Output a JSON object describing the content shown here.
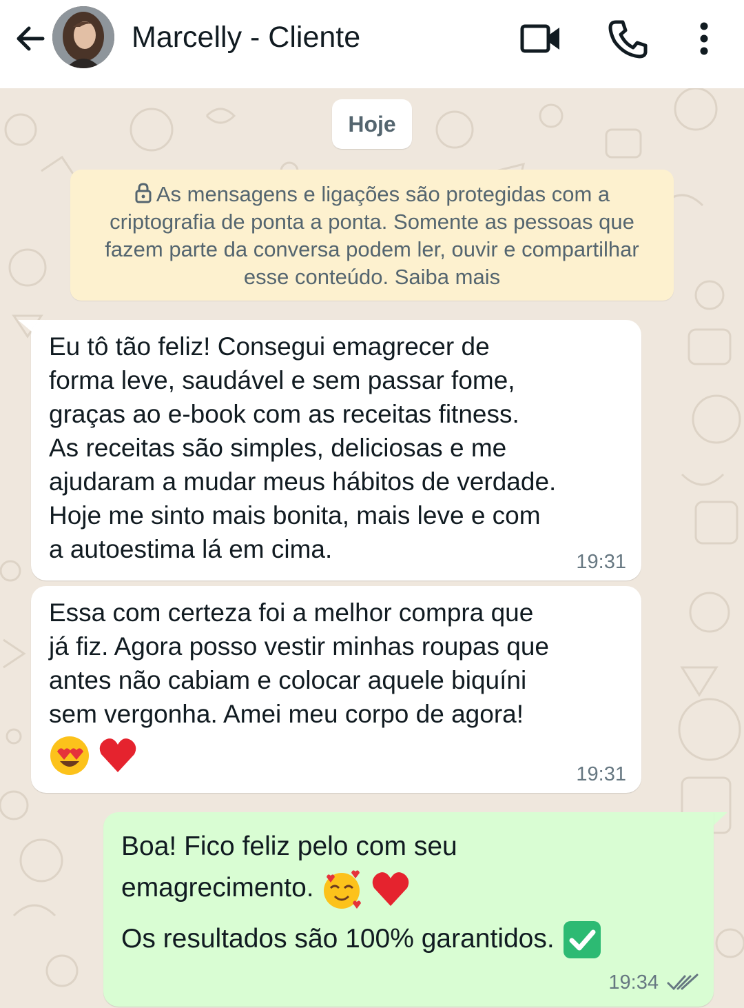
{
  "header": {
    "title": "Marcelly - Cliente",
    "icons": [
      "back-arrow-icon",
      "avatar",
      "video-call-icon",
      "voice-call-icon",
      "more-options-icon"
    ]
  },
  "chat": {
    "date_chip": "Hoje",
    "encryption_notice": "As mensagens e ligações são protegidas com a criptografia de ponta a ponta. Somente as pessoas que fazem parte da conversa podem ler, ouvir e compartilhar esse conteúdo. Saiba mais",
    "messages": [
      {
        "direction": "incoming",
        "lines": [
          "Eu tô tão feliz! Consegui emagrecer de",
          "forma leve, saudável e sem passar fome,",
          "graças ao e-book com as receitas fitness.",
          "As receitas são simples, deliciosas e me",
          "ajudaram a mudar meus hábitos de verdade.",
          "Hoje me sinto mais bonita, mais leve e com",
          "a autoestima lá em cima."
        ],
        "time": "19:31"
      },
      {
        "direction": "incoming",
        "lines": [
          "Essa com certeza foi a melhor compra que",
          "já fiz. Agora posso vestir minhas roupas que",
          "antes não cabiam e colocar aquele biquíni",
          "sem vergonha. Amei meu corpo de agora!"
        ],
        "emojis": [
          "heart-eyes-emoji",
          "red-heart-emoji"
        ],
        "time": "19:31"
      },
      {
        "direction": "outgoing",
        "line1": "Boa! Fico feliz pelo com seu",
        "line2": "emagrecimento.",
        "line2_emojis": [
          "smiling-face-with-hearts-emoji",
          "red-heart-emoji"
        ],
        "line3": "Os resultados são 100% garantidos.",
        "line3_emojis": [
          "check-mark-button-emoji"
        ],
        "time": "19:34",
        "status": "double-tick-icon"
      }
    ]
  },
  "colors": {
    "header_bg": "#ffffff",
    "chat_bg": "#efe7dd",
    "incoming_bubble": "#ffffff",
    "outgoing_bubble": "#d9fdd3",
    "encryption_bg": "#fdf1cf",
    "text_primary": "#111b21",
    "text_secondary": "#667781"
  }
}
